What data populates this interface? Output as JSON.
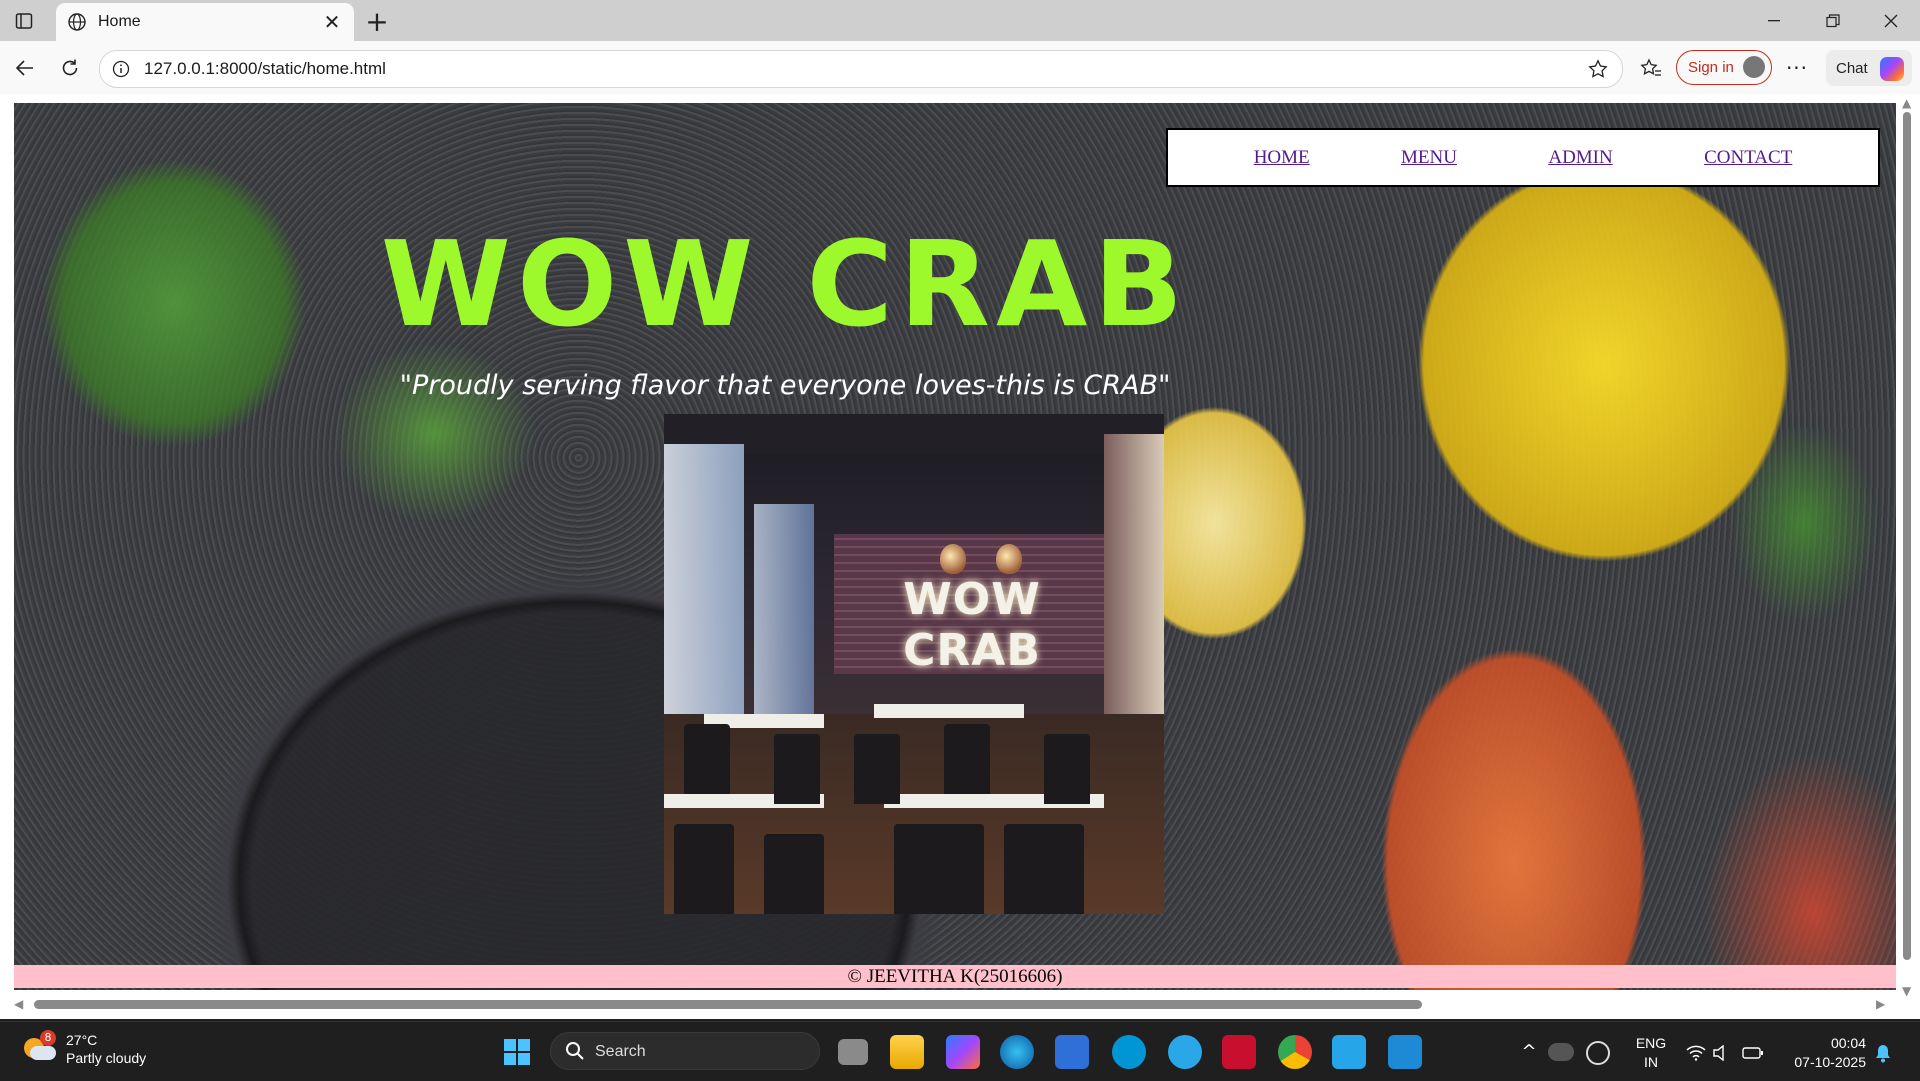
{
  "browser": {
    "tab_title": "Home",
    "url": "127.0.0.1:8000/static/home.html",
    "signin_label": "Sign in",
    "chat_label": "Chat"
  },
  "page": {
    "nav": [
      "HOME",
      "MENU",
      "ADMIN",
      "CONTACT"
    ],
    "title": "WOW CRAB",
    "tagline": "\"Proudly serving flavor that everyone loves-this is CRAB\"",
    "photo_sign": "WOW CRAB",
    "footer": "© JEEVITHA K(25016606)"
  },
  "taskbar": {
    "weather_temp": "27°C",
    "weather_desc": "Partly cloudy",
    "weather_badge": "8",
    "search_label": "Search",
    "lang_line1": "ENG",
    "lang_line2": "IN",
    "time": "00:04",
    "date": "07-10-2025"
  },
  "colors": {
    "title": "#9ef92c",
    "footer_bg": "#ffc0cb",
    "link": "#551a8b",
    "signin": "#c42b1c"
  }
}
